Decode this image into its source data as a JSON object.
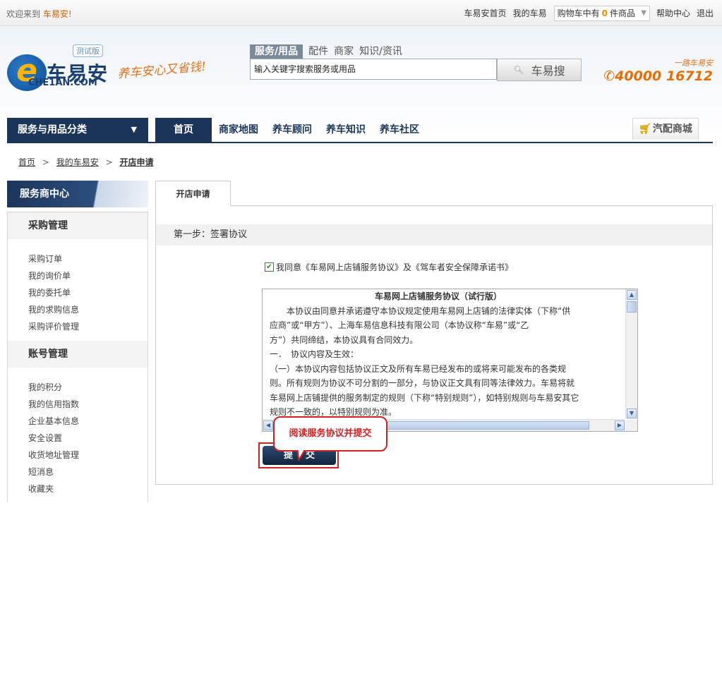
{
  "topbar": {
    "welcome_prefix": "欢迎来到",
    "welcome_brand": "车易安!",
    "links": [
      "车易安首页",
      "我的车易"
    ],
    "cart_prefix": "购物车中有",
    "cart_count": "0",
    "cart_suffix": "件商品",
    "help": "帮助中心",
    "logout": "退出"
  },
  "header": {
    "logo_letter": "e",
    "logo_cn": "车易安",
    "logo_en": "CHE1AN.COM",
    "beta_badge": "测试版",
    "slogan": "养车安心又省钱!",
    "search_tabs": [
      "服务/用品",
      "配件",
      "商家",
      "知识/资讯"
    ],
    "search_value": "输入关键字搜索服务或用品",
    "search_button": "车易搜",
    "hotline_tag": "一路车易安",
    "hotline_number": "40000 16712"
  },
  "nav": {
    "category": "服务与用品分类",
    "items": [
      "首页",
      "商家地图",
      "养车顾问",
      "养车知识",
      "养车社区"
    ],
    "shop": "汽配商城"
  },
  "breadcrumb": {
    "items": [
      "首页",
      "我的车易安",
      "开店申请"
    ],
    "separator": ">"
  },
  "sidebar": {
    "title": "服务商中心",
    "groups": [
      {
        "title": "采购管理",
        "items": [
          "采购订单",
          "我的询价单",
          "我的委托单",
          "我的求购信息",
          "采购评价管理"
        ]
      },
      {
        "title": "账号管理",
        "items": [
          "我的积分",
          "我的信用指数",
          "企业基本信息",
          "安全设置",
          "收货地址管理",
          "短消息",
          "收藏夹"
        ]
      }
    ]
  },
  "main": {
    "tab": "开店申请",
    "step": "第一步：签署协议",
    "agree_text": "我同意《车易网上店铺服务协议》及《驾车者安全保障承诺书》",
    "agree_checked": true,
    "terms_title": "车易网上店铺服务协议（试行版）",
    "terms_lines": [
      "　　本协议由同意并承诺遵守本协议规定使用车易网上店铺的法律实体（下称“供",
      "应商”或“甲方”）、上海车易信息科技有限公司（本协议称“车易”或“乙",
      "方”）共同缔结，本协议具有合同效力。",
      "一．　协议内容及生效：",
      "（一）本协议内容包括协议正文及所有车易已经发布的或将来可能发布的各类规",
      "则。所有规则为协议不可分割的一部分，与协议正文具有同等法律效力。车易将就",
      "车易网上店铺提供的服务制定的规则（下称“特别规则”），如特别规则与车易安其它",
      "规则不一致的，以特别规则为准。"
    ],
    "callout": "阅读服务协议并提交",
    "submit": "提交"
  }
}
